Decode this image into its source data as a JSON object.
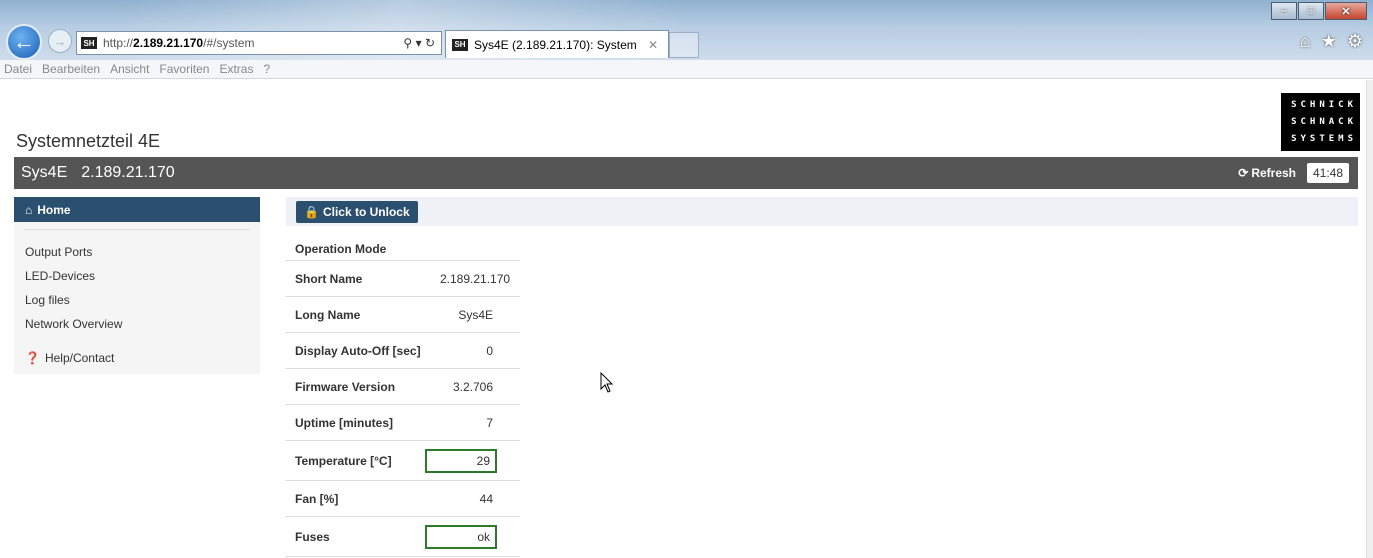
{
  "browser": {
    "url_prefix": "http://",
    "url_host": "2.189.21.170",
    "url_path": "/#/system",
    "site_icon": "SH",
    "tab_title": "Sys4E (2.189.21.170): System",
    "menu": [
      "Datei",
      "Bearbeiten",
      "Ansicht",
      "Favoriten",
      "Extras",
      "?"
    ]
  },
  "page": {
    "title": "Systemnetzteil 4E",
    "logo_lines": [
      "SCHNICK",
      "SCHNACK",
      "SYSTEMS"
    ]
  },
  "navbar": {
    "device": "Sys4E",
    "ip": "2.189.21.170",
    "refresh_label": "Refresh",
    "timer": "41:48"
  },
  "sidebar": {
    "home": "Home",
    "items": [
      "Output Ports",
      "LED-Devices",
      "Log files",
      "Network Overview"
    ],
    "help": "Help/Contact"
  },
  "actions": {
    "unlock_label": "Click to Unlock"
  },
  "system": {
    "heading": "Operation Mode",
    "rows": [
      {
        "label": "Short Name",
        "value": "2.189.21.170"
      },
      {
        "label": "Long Name",
        "value": "Sys4E"
      },
      {
        "label": "Display Auto-Off [sec]",
        "value": "0"
      },
      {
        "label": "Firmware Version",
        "value": "3.2.706"
      },
      {
        "label": "Uptime [minutes]",
        "value": "7"
      },
      {
        "label": "Temperature [°C]",
        "value": "29"
      },
      {
        "label": "Fan [%]",
        "value": "44"
      },
      {
        "label": "Fuses",
        "value": "ok"
      }
    ]
  },
  "colors": {
    "primary": "#2b4f6f",
    "navbar": "#555555",
    "ok_border": "#2d7a2d"
  }
}
